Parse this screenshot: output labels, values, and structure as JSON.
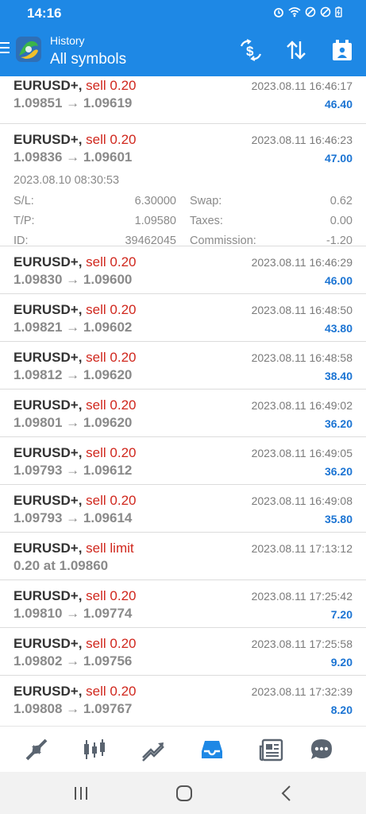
{
  "status": {
    "time": "14:16"
  },
  "header": {
    "subtitle": "History",
    "title": "All symbols"
  },
  "trades": [
    {
      "symbol": "EURUSD+,",
      "action": "sell 0.20",
      "prices": "1.09851 → 1.09619",
      "time": "2023.08.11 16:46:17",
      "profit": "46.40"
    },
    {
      "symbol": "EURUSD+,",
      "action": "sell 0.20",
      "prices": "1.09836 → 1.09601",
      "time": "2023.08.11 16:46:23",
      "profit": "47.00",
      "details": {
        "open_time": "2023.08.10 08:30:53",
        "sl_label": "S/L:",
        "sl": "6.30000",
        "tp_label": "T/P:",
        "tp": "1.09580",
        "id_label": "ID:",
        "id": "39462045",
        "swap_label": "Swap:",
        "swap": "0.62",
        "taxes_label": "Taxes:",
        "taxes": "0.00",
        "commission_label": "Commission:",
        "commission": "-1.20"
      }
    },
    {
      "symbol": "EURUSD+,",
      "action": "sell 0.20",
      "prices": "1.09830 → 1.09600",
      "time": "2023.08.11 16:46:29",
      "profit": "46.00"
    },
    {
      "symbol": "EURUSD+,",
      "action": "sell 0.20",
      "prices": "1.09821 → 1.09602",
      "time": "2023.08.11 16:48:50",
      "profit": "43.80"
    },
    {
      "symbol": "EURUSD+,",
      "action": "sell 0.20",
      "prices": "1.09812 → 1.09620",
      "time": "2023.08.11 16:48:58",
      "profit": "38.40"
    },
    {
      "symbol": "EURUSD+,",
      "action": "sell 0.20",
      "prices": "1.09801 → 1.09620",
      "time": "2023.08.11 16:49:02",
      "profit": "36.20"
    },
    {
      "symbol": "EURUSD+,",
      "action": "sell 0.20",
      "prices": "1.09793 → 1.09612",
      "time": "2023.08.11 16:49:05",
      "profit": "36.20"
    },
    {
      "symbol": "EURUSD+,",
      "action": "sell 0.20",
      "prices": "1.09793 → 1.09614",
      "time": "2023.08.11 16:49:08",
      "profit": "35.80"
    },
    {
      "symbol": "EURUSD+,",
      "action": "sell limit",
      "prices": "0.20 at 1.09860",
      "time": "2023.08.11 17:13:12",
      "profit": ""
    },
    {
      "symbol": "EURUSD+,",
      "action": "sell 0.20",
      "prices": "1.09810 → 1.09774",
      "time": "2023.08.11 17:25:42",
      "profit": "7.20"
    },
    {
      "symbol": "EURUSD+,",
      "action": "sell 0.20",
      "prices": "1.09802 → 1.09756",
      "time": "2023.08.11 17:25:58",
      "profit": "9.20"
    },
    {
      "symbol": "EURUSD+,",
      "action": "sell 0.20",
      "prices": "1.09808 → 1.09767",
      "time": "2023.08.11 17:32:39",
      "profit": "8.20"
    }
  ],
  "tabs": [
    "quotes-icon",
    "chart-icon",
    "trade-icon",
    "history-icon",
    "news-icon",
    "messages-icon"
  ],
  "colors": {
    "accent": "#1e88e5",
    "sell": "#d0271d",
    "profit": "#1b74d3"
  }
}
